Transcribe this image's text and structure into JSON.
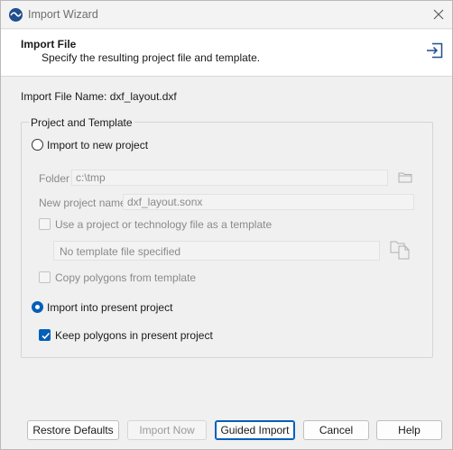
{
  "window": {
    "title": "Import Wizard"
  },
  "header": {
    "title": "Import File",
    "subtitle": "Specify the resulting project file and template.",
    "icon": "import-icon"
  },
  "import_file": {
    "label": "Import File Name:",
    "value": "dxf_layout.dxf"
  },
  "group": {
    "legend": "Project and Template",
    "import_new": {
      "label": "Import to new project",
      "checked": false
    },
    "folder": {
      "label": "Folder",
      "value": "c:\\tmp",
      "enabled": false
    },
    "new_project_name": {
      "label": "New project name",
      "value": "dxf_layout.sonx",
      "enabled": false
    },
    "use_template": {
      "label": "Use a project or technology file as a template",
      "checked": false,
      "enabled": false
    },
    "template_file": {
      "value": "No template file specified",
      "enabled": false
    },
    "copy_polygons": {
      "label": "Copy polygons from template",
      "checked": false,
      "enabled": false
    },
    "import_present": {
      "label": "Import into present project",
      "checked": true
    },
    "keep_polygons": {
      "label": "Keep polygons in present project",
      "checked": true
    }
  },
  "buttons": {
    "restore": "Restore Defaults",
    "import_now": "Import Now",
    "guided": "Guided Import",
    "cancel": "Cancel",
    "help": "Help"
  },
  "colors": {
    "accent": "#005fb8",
    "app_icon": "#1f4f8c"
  }
}
